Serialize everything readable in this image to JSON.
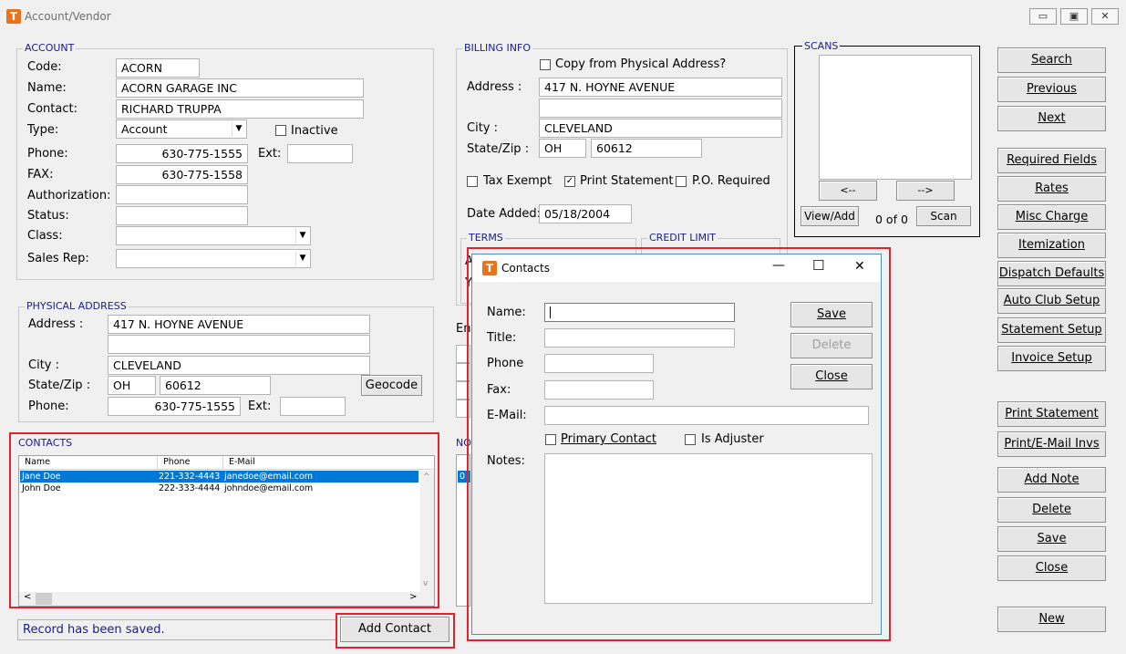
{
  "window": {
    "title": "Account/Vendor",
    "minimize": "▭",
    "restore": "▣",
    "close": "✕"
  },
  "account": {
    "group_title": "ACCOUNT",
    "code_label": "Code:",
    "code": "ACORN",
    "name_label": "Name:",
    "name": "ACORN GARAGE INC",
    "contact_label": "Contact:",
    "contact": "RICHARD TRUPPA",
    "type_label": "Type:",
    "type": "Account",
    "inactive_label": "Inactive",
    "phone_label": "Phone:",
    "phone": "630-775-1555",
    "ext_label": "Ext:",
    "fax_label": "FAX:",
    "fax": "630-775-1558",
    "authorization_label": "Authorization:",
    "status_label": "Status:",
    "class_label": "Class:",
    "sales_rep_label": "Sales Rep:"
  },
  "physical": {
    "group_title": "PHYSICAL ADDRESS",
    "address_label": "Address :",
    "address": "417 N. HOYNE AVENUE",
    "city_label": "City :",
    "city": "CLEVELAND",
    "state_zip_label": "State/Zip :",
    "state": "OH",
    "zip": "60612",
    "geocode": "Geocode",
    "phone_label": "Phone:",
    "phone": "630-775-1555",
    "ext_label": "Ext:"
  },
  "billing": {
    "group_title": "BILLING INFO",
    "copy_label": "Copy from Physical Address?",
    "address_label": "Address :",
    "address": "417 N. HOYNE AVENUE",
    "city_label": "City :",
    "city": "CLEVELAND",
    "state_zip_label": "State/Zip :",
    "state": "OH",
    "zip": "60612",
    "tax_exempt_label": "Tax Exempt",
    "print_statement_label": "Print Statement",
    "po_required_label": "P.O. Required",
    "date_added_label": "Date Added:",
    "date_added": "05/18/2004",
    "terms_title": "TERMS",
    "credit_limit_title": "CREDIT LIMIT",
    "terms_frag1": "A",
    "terms_frag2": "Y"
  },
  "scans": {
    "group_title": "SCANS",
    "prev": "<--",
    "next": "-->",
    "view_add": "View/Add",
    "count": "0 of 0",
    "scan": "Scan"
  },
  "hidden_fragments": {
    "entry": "Ent",
    "notes": "NO",
    "row": "0"
  },
  "contacts_list": {
    "group_title": "CONTACTS",
    "columns": [
      "Name",
      "Phone",
      "E-Mail"
    ],
    "rows": [
      {
        "name": "Jane Doe",
        "phone": "221-332-4443",
        "email": "janedoe@email.com"
      },
      {
        "name": "John Doe",
        "phone": "222-333-4444",
        "email": "johndoe@email.com"
      }
    ],
    "scroll_up": "^",
    "scroll_down": "v",
    "scroll_left": "<",
    "scroll_right": ">"
  },
  "status_text": "Record has been saved.",
  "add_contact": "Add Contact",
  "right_buttons": {
    "search": "Search",
    "previous": "Previous",
    "next": "Next",
    "required_fields": "Required Fields",
    "rates": "Rates",
    "misc_charge": "Misc Charge",
    "itemization": "Itemization",
    "dispatch_defaults": "Dispatch Defaults",
    "auto_club_setup": "Auto Club Setup",
    "statement_setup": "Statement Setup",
    "invoice_setup": "Invoice Setup",
    "print_statement": "Print Statement",
    "print_email_invs": "Print/E-Mail Invs",
    "add_note": "Add Note",
    "delete": "Delete",
    "save": "Save",
    "close": "Close",
    "new": "New"
  },
  "contacts_dialog": {
    "title": "Contacts",
    "minimize": "—",
    "maximize": "☐",
    "close": "✕",
    "name_label": "Name:",
    "title_label": "Title:",
    "phone_label": "Phone",
    "fax_label": "Fax:",
    "email_label": "E-Mail:",
    "primary_contact_label": "Primary Contact",
    "is_adjuster_label": "Is Adjuster",
    "notes_label": "Notes:",
    "save": "Save",
    "delete": "Delete",
    "close_btn": "Close"
  },
  "colors": {
    "highlight": "#e0242d",
    "selection": "#0078d7",
    "group_title": "#1a1a8c"
  }
}
